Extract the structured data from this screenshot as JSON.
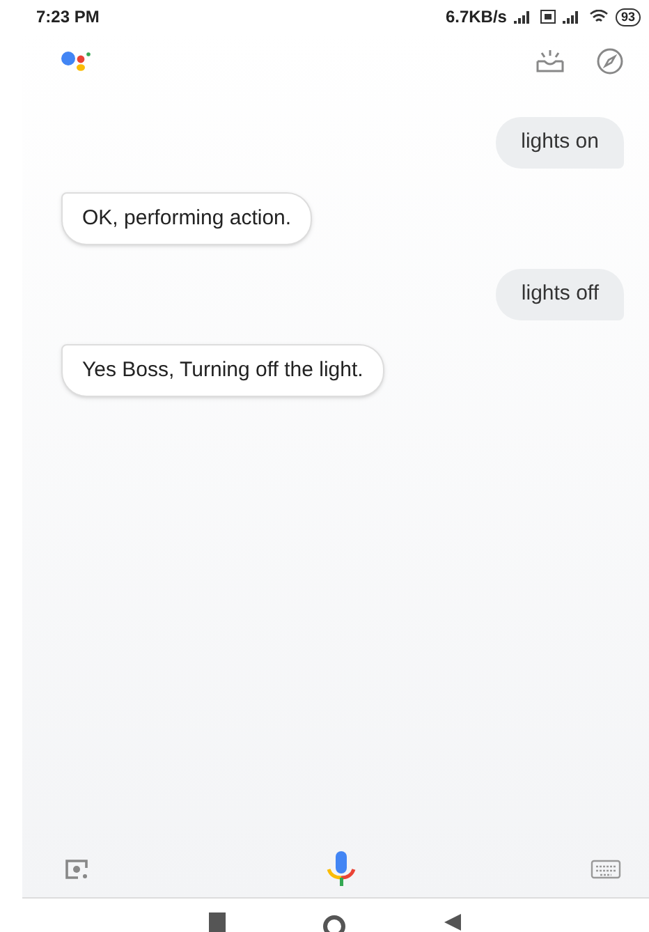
{
  "status_bar": {
    "time": "7:23 PM",
    "network_speed": "6.7KB/s",
    "battery": "93"
  },
  "messages": [
    {
      "kind": "user",
      "text": "lights on"
    },
    {
      "kind": "assistant",
      "text": "OK, performing action."
    },
    {
      "kind": "user",
      "text": "lights off"
    },
    {
      "kind": "assistant",
      "text": "Yes Boss, Turning off the light."
    }
  ]
}
